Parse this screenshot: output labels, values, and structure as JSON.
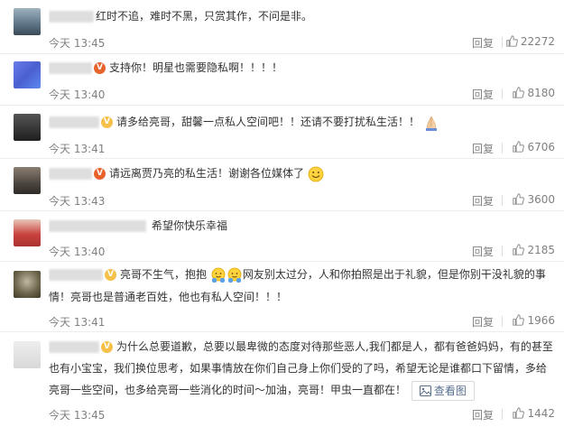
{
  "comments": [
    {
      "text": "红时不追，难时不黑，只赏其作，不问是非。",
      "time": "今天 13:45",
      "reply": "回复",
      "likes": "22272",
      "badge": "",
      "avatar_color": "#5c7486"
    },
    {
      "text": "支持你！明星也需要隐私啊！！！！",
      "time": "今天 13:40",
      "reply": "回复",
      "likes": "8180",
      "badge": "V",
      "avatar_color": "#4a5fd0"
    },
    {
      "text": "请多给亮哥，甜馨一点私人空间吧！！还请不要打扰私生活！！",
      "time": "今天 13:41",
      "reply": "回复",
      "likes": "6706",
      "badge": "V",
      "avatar_color": "#2a2a2a"
    },
    {
      "text": "请远离贾乃亮的私生活！谢谢各位媒体了",
      "time": "今天 13:43",
      "reply": "回复",
      "likes": "3600",
      "badge": "V",
      "avatar_color": "#4d4640"
    },
    {
      "text": "希望你快乐幸福",
      "time": "今天 13:40",
      "reply": "回复",
      "likes": "2185",
      "badge": "",
      "avatar_color": "#c9433f"
    },
    {
      "line1": "亮哥不生气，抱抱",
      "line1b": "网友别太过分，人和你拍照是出于礼貌，但是你别干没礼貌的事",
      "line2": "情！亮哥也是普通老百姓，他也有私人空间！！！",
      "time": "今天 13:41",
      "reply": "回复",
      "likes": "1966",
      "badge": "V",
      "avatar_color": "#6a6248"
    },
    {
      "line1": "为什么总要道歉，总要以最卑微的态度对待那些恶人,我们都是人，都有爸爸妈妈，有的甚至",
      "line2": "也有小宝宝，我们换位思考，如果事情放在你们自己身上你们受的了吗，希望无论是谁都口下留情，多给",
      "line3": "亮哥一些空间，也多给亮哥一些消化的时间～加油，亮哥！甲虫一直都在！",
      "view_pic": "查看图",
      "time": "今天 13:45",
      "reply": "回复",
      "likes": "1442",
      "badge": "V",
      "avatar_color": "#d8d8d8"
    }
  ],
  "icons": {
    "like": "thumbs-up-icon",
    "view": "image-icon",
    "emoji": "smile-emoji",
    "emoji_pray": "pray-emoji",
    "emoji_hug": "hug-emoji"
  },
  "colors": {
    "meta": "#808080",
    "badge_red": "#e8622c",
    "badge_yellow": "#f6c14a",
    "link": "#5a6f8f"
  }
}
